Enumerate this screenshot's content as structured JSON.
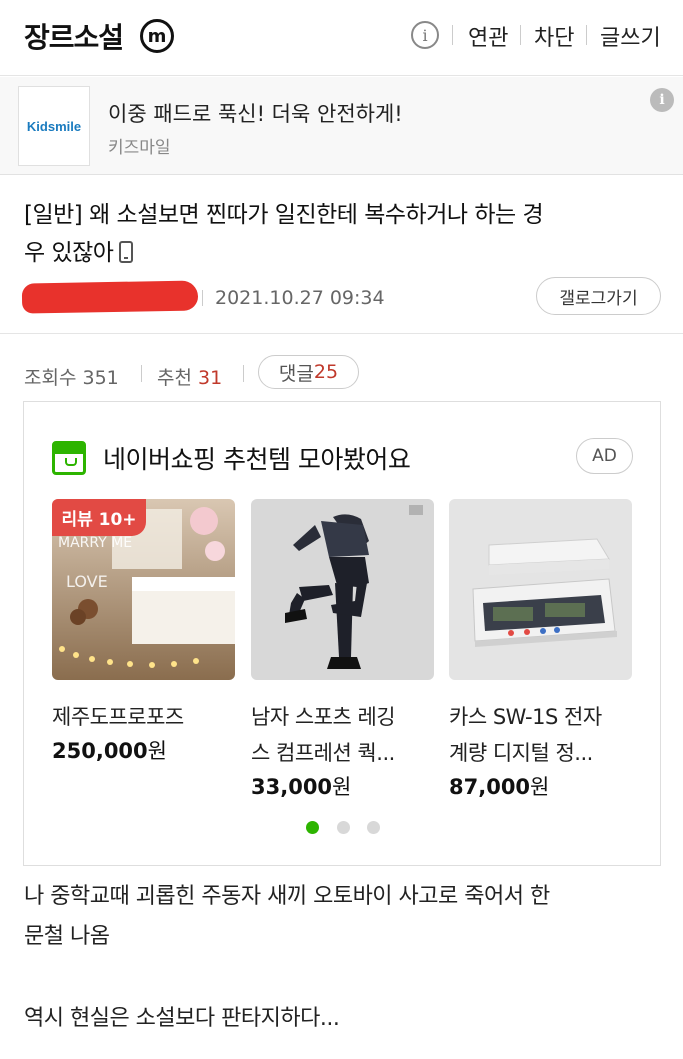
{
  "header": {
    "gallery_name": "장르소설",
    "badge_letter": "m",
    "info_icon": "i",
    "links": [
      "연관",
      "차단",
      "글쓰기"
    ]
  },
  "ad_banner": {
    "logo_text": "Kidsmile",
    "headline": "이중 패드로 푹신! 더욱 안전하게!",
    "advertiser": "키즈마일",
    "info_icon": "i"
  },
  "post": {
    "title_line1": "[일반] 왜 소설보면 찐따가 일진한테 복수하거나 하는 경",
    "title_line2": "우 있잖아",
    "date": "2021.10.27 09:34",
    "gallery_button": "갤로그가기"
  },
  "stats": {
    "views_label": "조회수",
    "views": "351",
    "recommend_label": "추천",
    "recommend": "31",
    "comments_label": "댓글",
    "comments": "25"
  },
  "shopping": {
    "title": "네이버쇼핑 추천템 모아봤어요",
    "ad_label": "AD",
    "products": [
      {
        "badge": "리뷰 10+",
        "name_line1": "제주도프로포즈",
        "name_line2": "",
        "price": "250,000",
        "unit": "원"
      },
      {
        "badge": "",
        "name_line1": "남자 스포츠 레깅",
        "name_line2": "스 컴프레션 쿽...",
        "price": "33,000",
        "unit": "원"
      },
      {
        "badge": "",
        "name_line1": "카스 SW-1S 전자",
        "name_line2": "계량 디지털 정...",
        "price": "87,000",
        "unit": "원"
      }
    ],
    "carousel_active_page": 1,
    "carousel_pages": 3
  },
  "body": {
    "line1": "나 중학교때 괴롭힌 주동자 새끼 오토바이 사고로 죽어서 한",
    "line2": "문철 나옴",
    "line3": "역시 현실은 소설보다 판타지하다..."
  },
  "colors": {
    "accent_red": "#c0392b",
    "naver_green": "#2db400",
    "redaction": "#e8322c"
  }
}
